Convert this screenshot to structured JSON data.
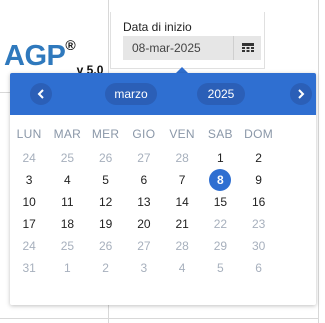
{
  "app": {
    "logo_text": "AGP",
    "logo_reg": "®",
    "logo_version": "v 5.0"
  },
  "date_field": {
    "label": "Data di inizio",
    "value": "08-mar-2025",
    "icon": "calendar-icon"
  },
  "picker": {
    "month": "marzo",
    "year": "2025",
    "prev_icon": "chevron-left-icon",
    "next_icon": "chevron-right-icon",
    "accent_color": "#2f6fd1",
    "weekdays": [
      "LUN",
      "MAR",
      "MER",
      "GIO",
      "VEN",
      "SAB",
      "DOM"
    ],
    "weeks": [
      [
        {
          "d": "24",
          "m": true
        },
        {
          "d": "25",
          "m": true
        },
        {
          "d": "26",
          "m": true
        },
        {
          "d": "27",
          "m": true
        },
        {
          "d": "28",
          "m": true
        },
        {
          "d": "1",
          "m": false
        },
        {
          "d": "2",
          "m": false
        }
      ],
      [
        {
          "d": "3",
          "m": false
        },
        {
          "d": "4",
          "m": false
        },
        {
          "d": "5",
          "m": false
        },
        {
          "d": "6",
          "m": false
        },
        {
          "d": "7",
          "m": false
        },
        {
          "d": "8",
          "m": false,
          "sel": true
        },
        {
          "d": "9",
          "m": false
        }
      ],
      [
        {
          "d": "10",
          "m": false
        },
        {
          "d": "11",
          "m": false
        },
        {
          "d": "12",
          "m": false
        },
        {
          "d": "13",
          "m": false
        },
        {
          "d": "14",
          "m": false
        },
        {
          "d": "15",
          "m": false
        },
        {
          "d": "16",
          "m": false
        }
      ],
      [
        {
          "d": "17",
          "m": false
        },
        {
          "d": "18",
          "m": false
        },
        {
          "d": "19",
          "m": false
        },
        {
          "d": "20",
          "m": false
        },
        {
          "d": "21",
          "m": false
        },
        {
          "d": "22",
          "m": true
        },
        {
          "d": "23",
          "m": true
        }
      ],
      [
        {
          "d": "24",
          "m": true
        },
        {
          "d": "25",
          "m": true
        },
        {
          "d": "26",
          "m": true
        },
        {
          "d": "27",
          "m": true
        },
        {
          "d": "28",
          "m": true
        },
        {
          "d": "29",
          "m": true
        },
        {
          "d": "30",
          "m": true
        }
      ],
      [
        {
          "d": "31",
          "m": true
        },
        {
          "d": "1",
          "m": true
        },
        {
          "d": "2",
          "m": true
        },
        {
          "d": "3",
          "m": true
        },
        {
          "d": "4",
          "m": true
        },
        {
          "d": "5",
          "m": true
        },
        {
          "d": "6",
          "m": true
        }
      ]
    ]
  }
}
